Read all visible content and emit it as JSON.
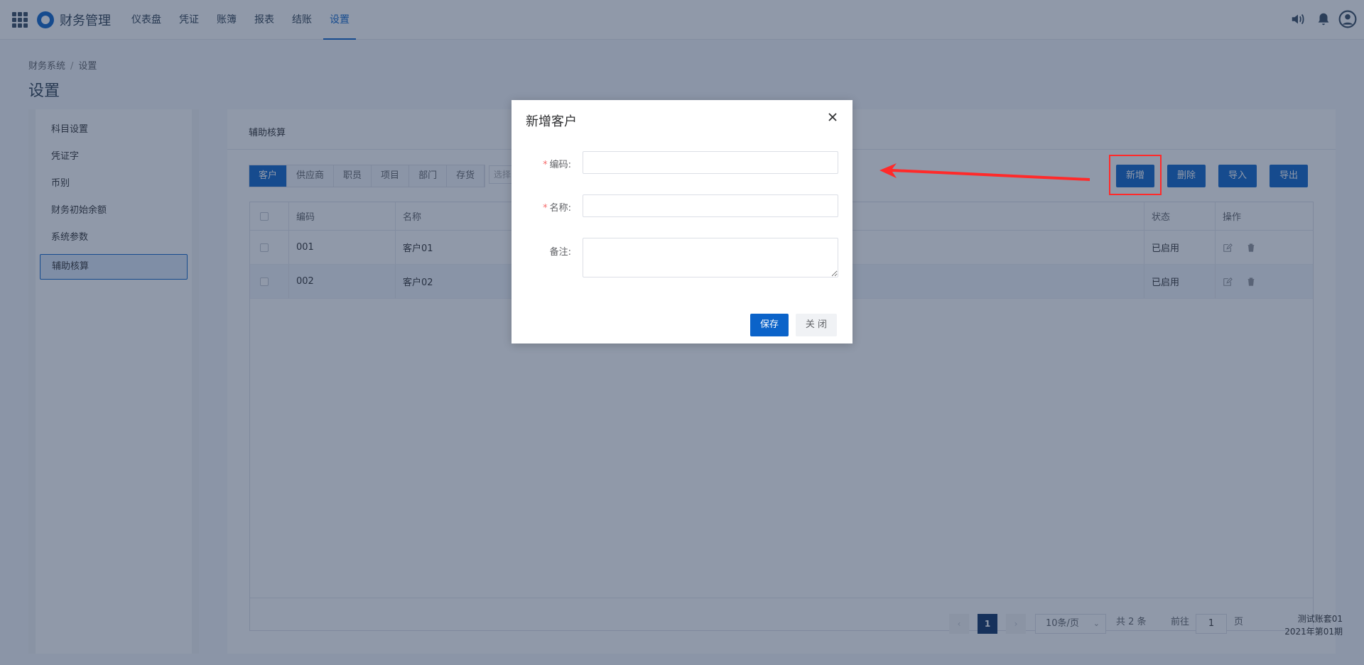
{
  "app": {
    "title": "财务管理"
  },
  "nav": [
    "仪表盘",
    "凭证",
    "账簿",
    "报表",
    "结账",
    "设置"
  ],
  "nav_active": "设置",
  "breadcrumb": {
    "root": "财务系统",
    "sep": "/",
    "current": "设置"
  },
  "page_title": "设置",
  "sidebar": {
    "items": [
      "科目设置",
      "凭证字",
      "币别",
      "财务初始余额",
      "系统参数",
      "辅助核算"
    ],
    "active": "辅助核算"
  },
  "content_tab": "辅助核算",
  "segments": [
    "客户",
    "供应商",
    "职员",
    "项目",
    "部门",
    "存货"
  ],
  "segment_active": "客户",
  "select_placeholder": "选择",
  "toolbar": {
    "add": "新增",
    "delete": "删除",
    "import": "导入",
    "export": "导出"
  },
  "table": {
    "headers": {
      "code": "编码",
      "name": "名称",
      "status": "状态",
      "action": "操作"
    },
    "rows": [
      {
        "code": "001",
        "name": "客户01",
        "status": "已启用"
      },
      {
        "code": "002",
        "name": "客户02",
        "status": "已启用"
      }
    ]
  },
  "pagination": {
    "current": "1",
    "page_size": "10条/页",
    "total": "共 2 条",
    "goto_label": "前往",
    "goto_value": "1",
    "page_unit": "页"
  },
  "account": {
    "name": "测试账套01",
    "period": "2021年第01期"
  },
  "modal": {
    "title": "新增客户",
    "fields": {
      "code_label": "编码:",
      "name_label": "名称:",
      "note_label": "备注:"
    },
    "code_value": "",
    "name_value": "",
    "note_value": "",
    "save": "保存",
    "close": "关 闭"
  },
  "colors": {
    "primary": "#0b63c9",
    "annotation": "#ff2a2a"
  },
  "icons": [
    "apps-grid-icon",
    "logo-icon",
    "volume-icon",
    "bell-icon",
    "user-icon",
    "edit-icon",
    "trash-icon",
    "close-icon",
    "chevron-left-icon",
    "chevron-right-icon",
    "chevron-down-icon",
    "arrow-annotation"
  ]
}
